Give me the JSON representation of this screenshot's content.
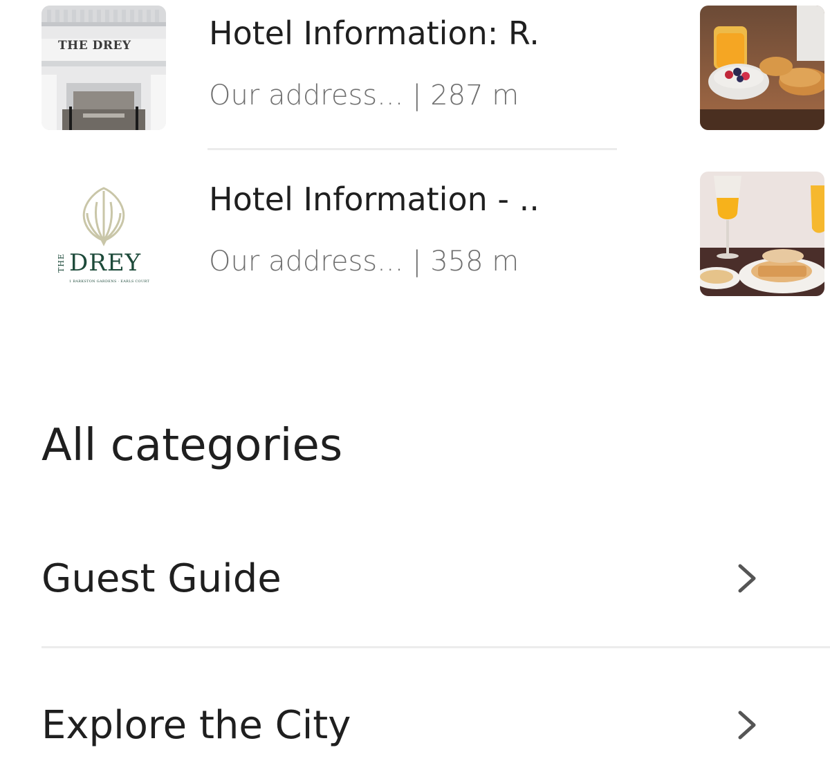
{
  "results": [
    {
      "title": "Hotel Information: R.",
      "subtitle": "Our address... | 287 m",
      "left_image": "hotel-facade-photo",
      "left_image_sign": "THE DREY",
      "right_image": "breakfast-photo"
    },
    {
      "title": "Hotel Information - ..",
      "subtitle": "Our address... | 358 m",
      "left_image": "the-drey-logo",
      "logo_text": "DREY",
      "logo_vertical": "THE",
      "logo_tagline": "1 BARKSTON GARDENS · EARLS COURT",
      "right_image": "orange-juice-breakfast-photo"
    }
  ],
  "section_title": "All categories",
  "categories": [
    {
      "label": "Guest Guide",
      "icon": "chevron-right-icon"
    },
    {
      "label": "Explore the City",
      "icon": "chevron-right-icon"
    }
  ],
  "colors": {
    "text_primary": "#1f1f1f",
    "text_secondary": "#707070",
    "divider": "#ececec",
    "logo_green": "#1d4a3a",
    "chevron": "#555555"
  }
}
